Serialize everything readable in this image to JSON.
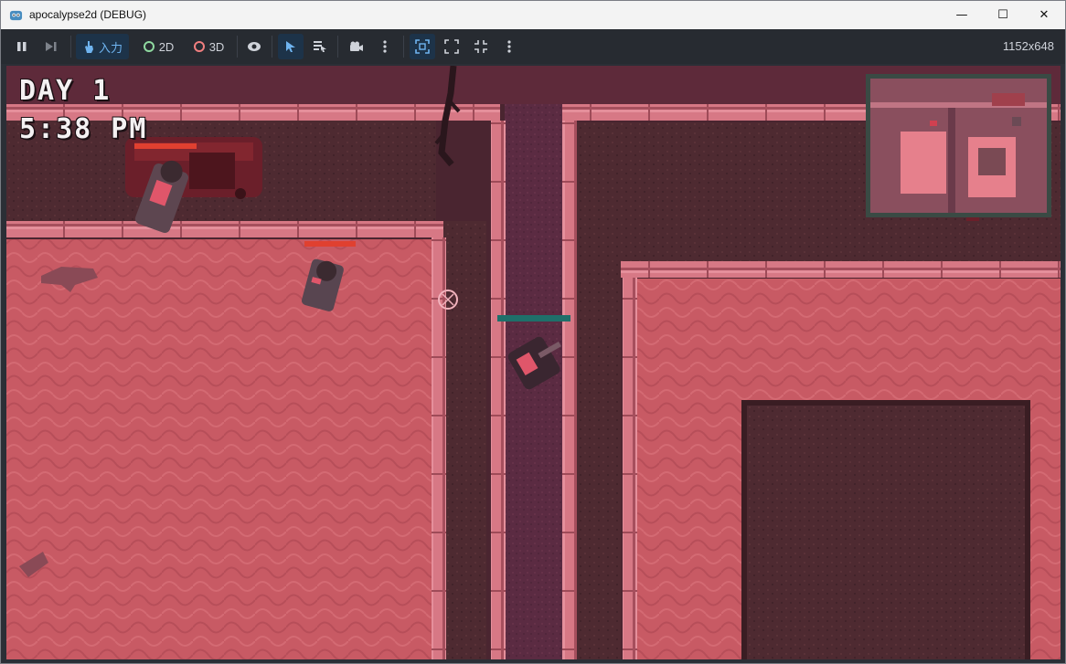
{
  "window": {
    "title": "apocalypse2d (DEBUG)",
    "controls": {
      "minimize": "—",
      "maximize": "☐",
      "close": "✕"
    }
  },
  "toolbar": {
    "pause_icon": "pause-icon",
    "next_frame_icon": "next-frame-icon",
    "input_label": "入力",
    "mode_2d": "2D",
    "mode_3d": "3D",
    "resolution": "1152x648"
  },
  "hud": {
    "day": "DAY 1",
    "time": "5:38 PM"
  },
  "colors": {
    "floor": "#c85a64",
    "wall": "#d97a86",
    "dirt": "#4a2a30",
    "road": "#5a2a40",
    "health_enemy": "#e04030",
    "health_player": "#1f6f6a"
  }
}
